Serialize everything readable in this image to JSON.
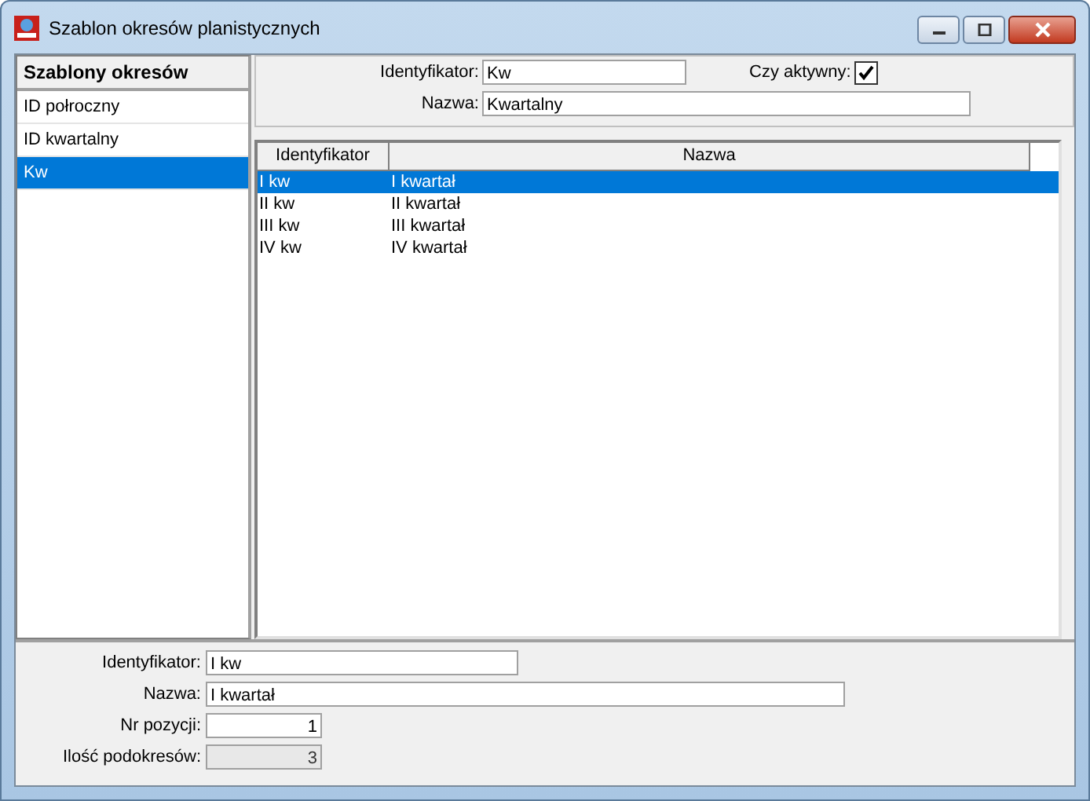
{
  "window": {
    "title": "Szablon okresów planistycznych"
  },
  "templates": {
    "heading": "Szablony okresów",
    "items": [
      {
        "label": "ID połroczny",
        "selected": false
      },
      {
        "label": "ID kwartalny",
        "selected": false
      },
      {
        "label": "Kw",
        "selected": true
      }
    ]
  },
  "header_form": {
    "id_label": "Identyfikator:",
    "id_value": "Kw",
    "active_label": "Czy aktywny:",
    "active": true,
    "name_label": "Nazwa:",
    "name_value": "Kwartalny"
  },
  "table": {
    "columns": [
      "Identyfikator",
      "Nazwa"
    ],
    "rows": [
      {
        "cells": [
          "I kw",
          "I kwartał"
        ],
        "selected": true
      },
      {
        "cells": [
          "II kw",
          "II kwartał"
        ],
        "selected": false
      },
      {
        "cells": [
          "III kw",
          "III kwartał"
        ],
        "selected": false
      },
      {
        "cells": [
          "IV kw",
          "IV kwartał"
        ],
        "selected": false
      }
    ]
  },
  "detail_form": {
    "fields": [
      {
        "label": "Identyfikator:",
        "value": "I kw",
        "kind": "text",
        "disabled": false
      },
      {
        "label": "Nazwa:",
        "value": "I kwartał",
        "kind": "wide",
        "disabled": false
      },
      {
        "label": "Nr pozycji:",
        "value": "1",
        "kind": "number",
        "disabled": false
      },
      {
        "label": "Ilość podokresów:",
        "value": "3",
        "kind": "number",
        "disabled": true
      }
    ]
  }
}
